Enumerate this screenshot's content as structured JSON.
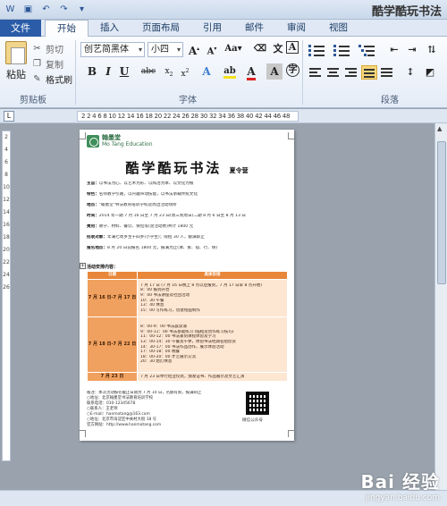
{
  "window": {
    "title": "酷学酷玩书法"
  },
  "tabs": {
    "file": "文件",
    "items": [
      "开始",
      "插入",
      "页面布局",
      "引用",
      "邮件",
      "审阅",
      "视图"
    ]
  },
  "clipboard": {
    "paste": "粘贴",
    "cut": "剪切",
    "copy": "复制",
    "format_painter": "格式刷",
    "group_label": "剪贴板"
  },
  "font": {
    "family": "创艺简黑体",
    "size": "小四",
    "group_label": "字体"
  },
  "paragraph": {
    "group_label": "段落"
  },
  "ruler": {
    "marks": "2  2  4  6  8  10 12 14 16 18 20 22 24 26 28 30 32 34 36 38 40 42 44 46 48"
  },
  "vruler": {
    "marks": [
      "2",
      "4",
      "6",
      "8",
      "10",
      "12",
      "14",
      "16",
      "18",
      "20",
      "22",
      "24",
      "26"
    ]
  },
  "document": {
    "logo_main": "翰墨堂",
    "logo_sub": "Mo Tang Education",
    "title": "酷学酷玩书法",
    "title_suffix": "夏令营",
    "info": [
      {
        "k": "主旨：",
        "v": "以书法为心、以艺术为形、以陶冶为本、以文化为根"
      },
      {
        "k": "特色：",
        "v": "名师教学引路，以兴趣带动技能，以书法承载传统文化"
      },
      {
        "k": "地点：",
        "v": "\"翰墨堂\"书法教育培训学校及周边活动场所"
      },
      {
        "k": "时间：",
        "v": "2014 年一期 7 月 16 日至 7 月 23 日(周三到周日)二期 8 月 6 日至 8 月 13 日"
      },
      {
        "k": "费用：",
        "v": "教学、材料、餐饮、保险等(含活动费)共计 1800 元"
      },
      {
        "k": "招收对象：",
        "v": "年满七周岁至十四岁(小学生)；限招 30 人，额满即止"
      },
      {
        "k": "报名地点：",
        "v": "8 月 20 日前报名 1800 元，报满为止(课、食、宿、行、保)"
      }
    ],
    "schedule_label": "活动安排内容：",
    "table_headers": [
      "日期",
      "具体安排"
    ],
    "schedule": [
      {
        "day": "7 月 16 日-7 月 17 日",
        "lines": [
          "7 月 17 日 (7 月 16 日晚上 8 点以后报到，7 月 17 日早 8 点开始)",
          "8：00 报到开营",
          "9：00 书法讲座及社团活动",
          "10：30 午餐",
          "13：40 休息",
          "15：00 写作练习，创意绘画制作"
        ]
      },
      {
        "day": "7 月 18 日-7 月 22 日",
        "lines": [
          "8：00-9：00 书法晨读诵",
          "9：00-11：00 书法基础练习 (临帖及创作练习技巧)",
          "11：00-12：00 书法篆刻课程体验及学习",
          "13：00-14：30 午餐及午休，体验书法经典名帖欣赏",
          "14：30-17：00 书法作品创作，展示体验活动",
          "17：00-18：00 晚餐",
          "18：00-20：00 才艺展示交流",
          "20：30 熄灯休息"
        ]
      },
      {
        "day": "7 月 23 日",
        "lines": [
          "7 月 23 日举行结业仪式，颁发证书、作品展示及文艺汇演"
        ]
      }
    ],
    "footer": [
      "备注：本次活动报名截止日期为 7 月 10 日，名额有限，报满即止",
      "○地址：北京翰墨堂书法教育培训学校",
      "联系电话：010-12345678",
      "○联系人：王老师",
      "○E-mail：hanmotang@163.com",
      "○地址：北京市海淀区中关村大街 18 号",
      "官方网站：http://www.hanmotang.com"
    ],
    "qr_label": "微信公众号"
  },
  "watermark": {
    "main": "Bai 经验",
    "sub": "jingyan.baidu.com"
  }
}
